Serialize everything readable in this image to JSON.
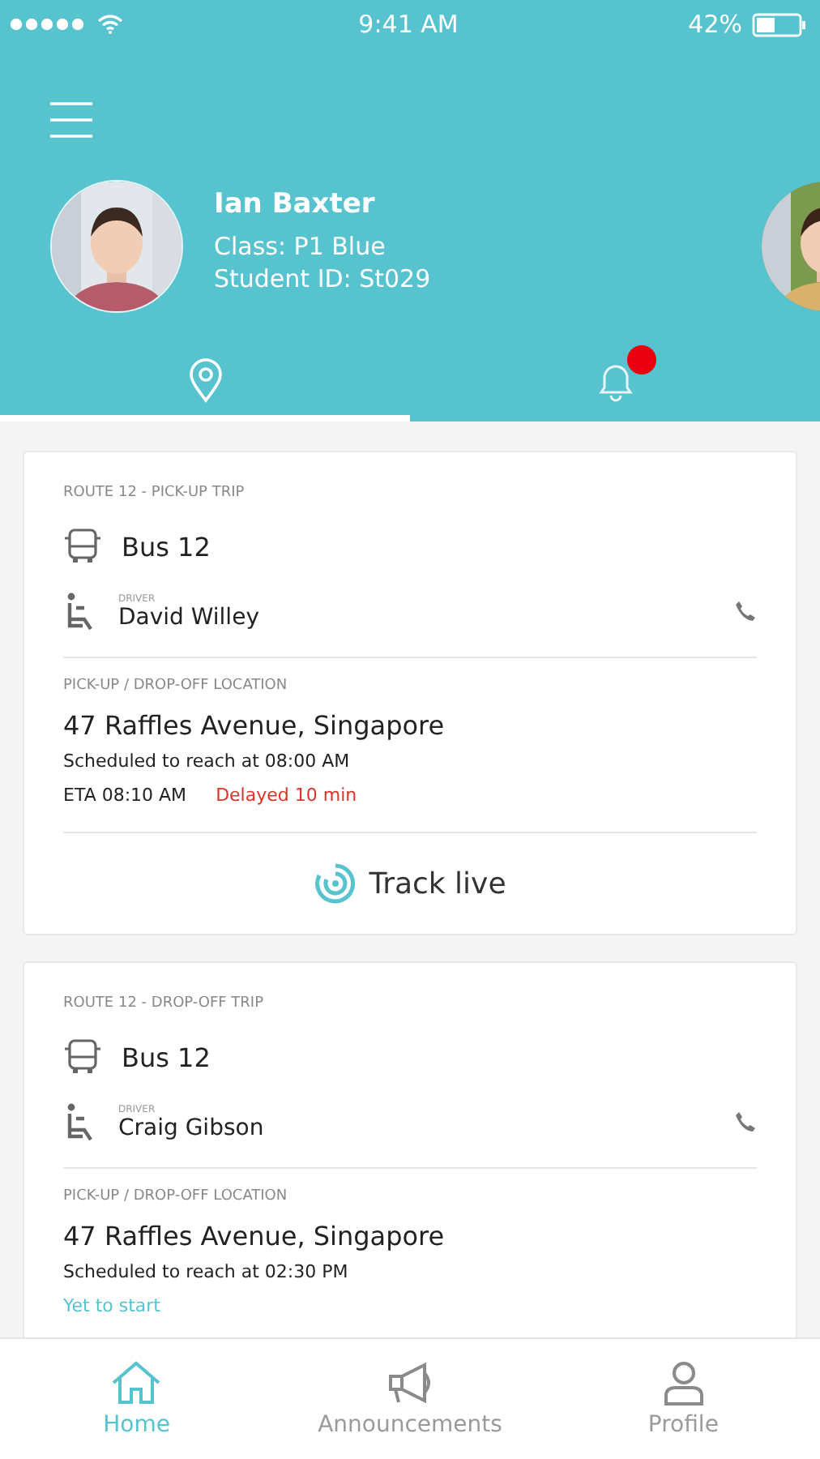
{
  "status_bar": {
    "time": "9:41 AM",
    "battery": "42%"
  },
  "student": {
    "name": "Ian Baxter",
    "class": "Class: P1 Blue",
    "id": "Student ID: St029"
  },
  "tabs": [
    {
      "kind": "location",
      "selected": true,
      "alert": false
    },
    {
      "kind": "notifications",
      "selected": false,
      "alert": true
    }
  ],
  "trips": [
    {
      "title": "ROUTE 12 - PICK-UP TRIP",
      "bus": "Bus 12",
      "driver_label": "DRIVER",
      "driver": "David Willey",
      "location_label": "PICK-UP / DROP-OFF LOCATION",
      "address": "47 Raffles Avenue, Singapore",
      "scheduled": "Scheduled to reach at 08:00 AM",
      "eta": "ETA 08:10 AM",
      "status": {
        "kind": "delayed",
        "text": "Delayed 10 min"
      },
      "action": "Track live"
    },
    {
      "title": "ROUTE 12 - DROP-OFF TRIP",
      "bus": "Bus 12",
      "driver_label": "DRIVER",
      "driver": "Craig Gibson",
      "location_label": "PICK-UP / DROP-OFF LOCATION",
      "address": "47 Raffles Avenue, Singapore",
      "scheduled": "Scheduled to reach at 02:30 PM",
      "status": {
        "kind": "pending",
        "text": "Yet to start"
      }
    }
  ],
  "nav": [
    {
      "kind": "home",
      "label": "Home",
      "selected": true
    },
    {
      "kind": "announcements",
      "label": "Announcements",
      "selected": false
    },
    {
      "kind": "profile",
      "label": "Profile",
      "selected": false
    }
  ]
}
